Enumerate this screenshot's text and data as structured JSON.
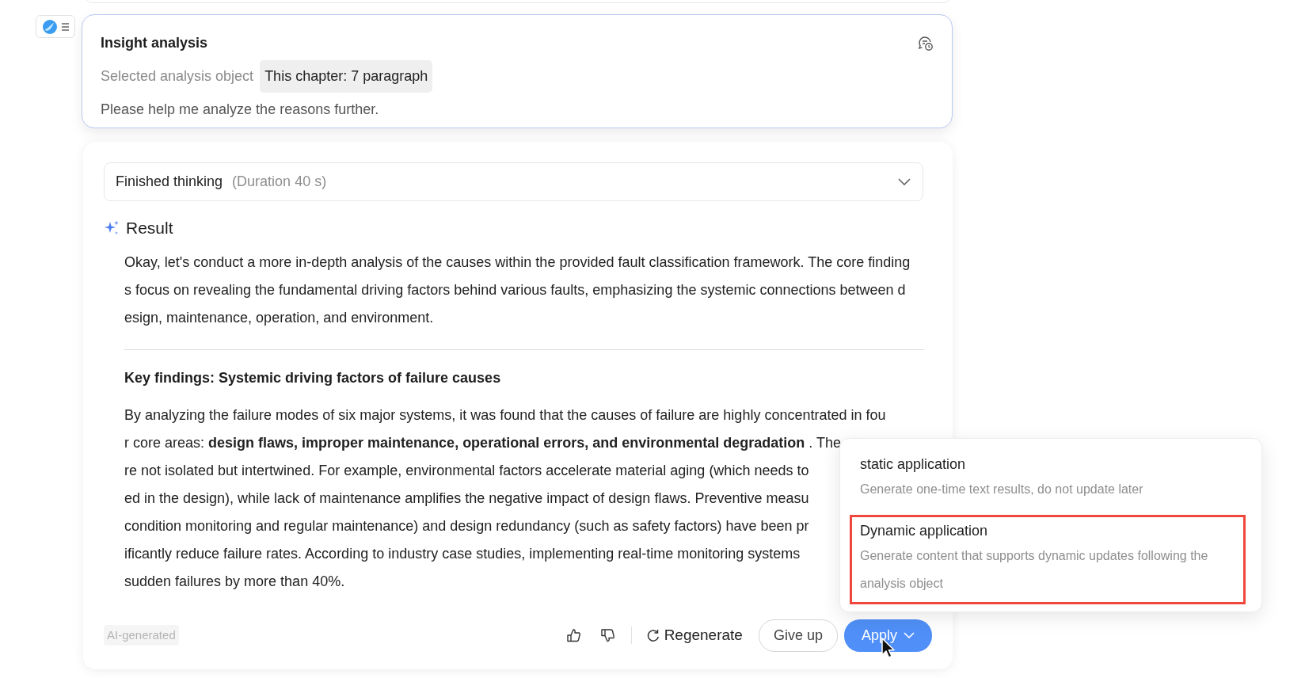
{
  "insight_card": {
    "title": "Insight analysis",
    "object_label": "Selected analysis object",
    "object_value": "This chapter: 7 paragraph",
    "prompt": "Please help me analyze the reasons further."
  },
  "thinking": {
    "label": "Finished thinking",
    "duration": "(Duration 40 s)",
    "expanded": false
  },
  "result": {
    "heading": "Result",
    "intro": "Okay, let's conduct a more in-depth analysis of the causes within the provided fault classification framework. The core findings focus on revealing the fundamental driving factors behind various faults, emphasizing the systemic connections between design, maintenance, operation, and environment.",
    "key_heading": "Key findings: Systemic driving factors of failure causes",
    "key_lines": [
      "By analyzing the failure modes of six major systems, it was found that the causes of failure are highly concentrated in fou",
      "r core areas: **design flaws, improper maintenance, operational errors, and environmental degradation** . The",
      "re not isolated but intertwined. For example, environmental factors accelerate material aging (which needs to",
      "ed in the design), while lack of maintenance amplifies the negative impact of design flaws. Preventive measu",
      "condition monitoring and regular maintenance) and design redundancy (such as safety factors) have been pr",
      "ificantly reduce failure rates. According to industry case studies, implementing real-time monitoring systems",
      "sudden failures by more than 40%."
    ]
  },
  "footer": {
    "badge": "AI-generated",
    "regenerate": "Regenerate",
    "give_up": "Give up",
    "apply": "Apply"
  },
  "apply_menu": [
    {
      "title": "static application",
      "description": "Generate one-time text results, do not update later",
      "highlighted": false
    },
    {
      "title": "Dynamic application",
      "description": "Generate content that supports dynamic updates following the analysis object",
      "highlighted": true
    }
  ]
}
